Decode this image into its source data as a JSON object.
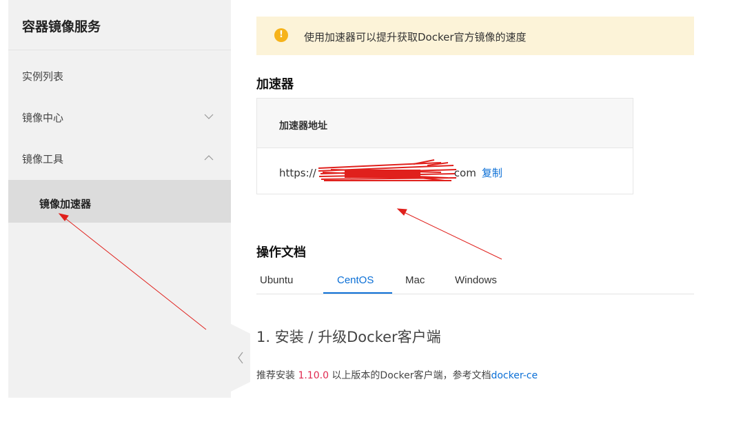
{
  "sidebar": {
    "title": "容器镜像服务",
    "items": [
      {
        "label": "实例列表"
      },
      {
        "label": "镜像中心",
        "chevron": "chevron-down-icon"
      },
      {
        "label": "镜像工具",
        "chevron": "chevron-up-icon"
      }
    ],
    "sub_item": {
      "label": "镜像加速器"
    }
  },
  "notice": {
    "icon": "warning-icon",
    "text": "使用加速器可以提升获取Docker官方镜像的速度"
  },
  "accelerator": {
    "heading": "加速器",
    "column_header": "加速器地址",
    "url_prefix": "https://",
    "url_suffix": "com",
    "copy_label": "复制"
  },
  "docs": {
    "heading": "操作文档",
    "tabs": [
      "Ubuntu",
      "CentOS",
      "Mac",
      "Windows"
    ],
    "active_tab": "CentOS",
    "step1_title": "1. 安装 / 升级Docker客户端",
    "step1_prefix": "推荐安装 ",
    "step1_version": "1.10.0",
    "step1_middle": " 以上版本的Docker客户端，参考文档",
    "step1_link": "docker-ce"
  },
  "colors": {
    "accent": "#0b6fd6",
    "warning": "#f6b31b",
    "version_highlight": "#e0284f",
    "annotation": "#e0201c"
  }
}
